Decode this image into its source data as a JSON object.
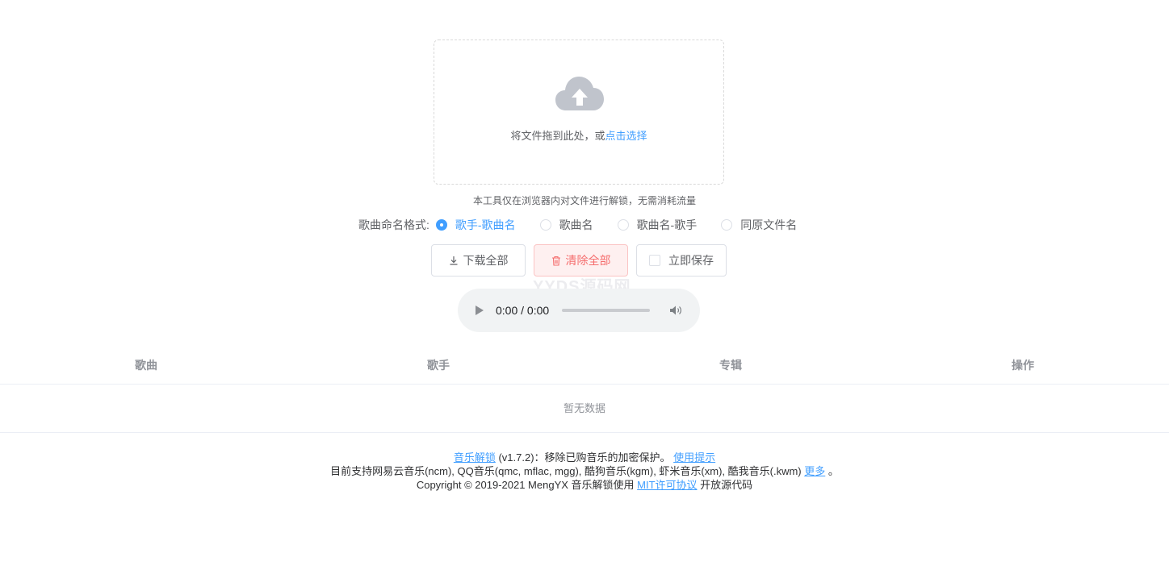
{
  "upload": {
    "prompt": "将文件拖到此处，或",
    "link": "点击选择"
  },
  "tip": "本工具仅在浏览器内对文件进行解锁，无需消耗流量",
  "naming": {
    "label": "歌曲命名格式:",
    "options": [
      "歌手-歌曲名",
      "歌曲名",
      "歌曲名-歌手",
      "同原文件名"
    ],
    "selected": "歌手-歌曲名"
  },
  "actions": {
    "download_all": "下载全部",
    "clear_all": "清除全部",
    "save_now": "立即保存"
  },
  "watermark": "YYDS源码网",
  "player": {
    "time": "0:00 / 0:00"
  },
  "table": {
    "columns": [
      "歌曲",
      "歌手",
      "专辑",
      "操作"
    ],
    "empty_text": "暂无数据"
  },
  "footer": {
    "app_link": "音乐解锁",
    "version_text": " (v1.7.2)：移除已购音乐的加密保护。 ",
    "tips_link": "使用提示",
    "support_text": "目前支持网易云音乐(ncm), QQ音乐(qmc, mflac, mgg), 酷狗音乐(kgm), 虾米音乐(xm), 酷我音乐(.kwm) ",
    "more_link": "更多",
    "support_end": " 。",
    "copyright_text": "Copyright © 2019-2021 MengYX 音乐解锁使用 ",
    "license_link": "MIT许可协议",
    "open_source_text": " 开放源代码"
  },
  "colors": {
    "primary": "#409eff",
    "danger": "#f56c6c",
    "muted": "#909399"
  },
  "icons": [
    "cloud-upload-icon",
    "download-icon",
    "trash-icon",
    "play-icon",
    "volume-icon"
  ]
}
